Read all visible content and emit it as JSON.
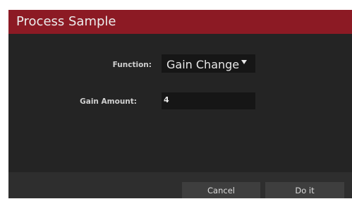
{
  "dialog": {
    "title": "Process Sample",
    "function_label": "Function:",
    "function_value": "Gain Change",
    "gain_label": "Gain Amount:",
    "gain_value": "4",
    "cancel_label": "Cancel",
    "doit_label": "Do it"
  },
  "colors": {
    "titlebar": "#8c1a24",
    "body": "#242424",
    "footer": "#2e2e2e",
    "button": "#3e3e3e"
  },
  "icons": {
    "dropdown": "chevron-down-icon"
  }
}
